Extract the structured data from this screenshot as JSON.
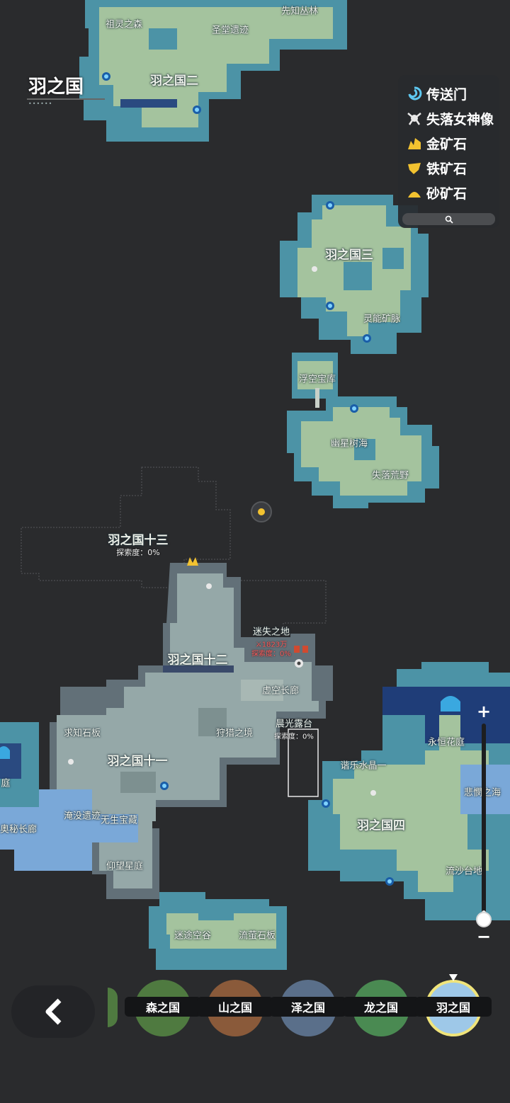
{
  "header": {
    "title": "羽之国",
    "dots": "••••••"
  },
  "legend": {
    "items": [
      {
        "label": "传送门",
        "icon": "teleport-swirl-icon",
        "color": "#5ec8f0"
      },
      {
        "label": "失落女神像",
        "icon": "goddess-statue-icon",
        "color": "#e8e8e8"
      },
      {
        "label": "金矿石",
        "icon": "gold-ore-icon",
        "color": "#f2c230"
      },
      {
        "label": "铁矿石",
        "icon": "iron-ore-icon",
        "color": "#f2c230"
      },
      {
        "label": "砂矿石",
        "icon": "sand-ore-icon",
        "color": "#f2c230"
      }
    ],
    "search_icon": "search-icon"
  },
  "map": {
    "labels": {
      "zulingzhisen": "祖灵之森",
      "xianzhicongling": "先知丛林",
      "shengtangyiji": "圣堂遗迹",
      "yu2": "羽之国二",
      "yu3": "羽之国三",
      "lingnengkuangmai": "灵能矿脉",
      "fukongbaoku": "浮空宝库",
      "youxingshuhai": "幽星树海",
      "shiluohuangye": "失落荒野",
      "yu13": "羽之国十三",
      "yu12": "羽之国十二",
      "mishizhidi": "迷失之地",
      "xukongchanglang": "虚空长廊",
      "chenguanglutai": "晨光露台",
      "qiuzhishiban": "求知石板",
      "shoulie": "狩猎之境",
      "yu11": "羽之国十一",
      "yanmoyiji": "淹没遗迹",
      "wushengbaozang": "无生宝藏",
      "yangwangxingting": "仰望星庭",
      "aomichanglang": "奥秘长廊",
      "ting": "庭",
      "yonghenghuating": "永恒花庭",
      "xieleshuijing": "谐乐水晶一",
      "beishanghai": "悲憫之海",
      "yu4": "羽之国四",
      "liushataidi": "流沙台地",
      "mituwkonggu": "迷途空谷",
      "liuyingshiban": "流萤石板"
    },
    "exploration": {
      "yu13": "探索度：0%",
      "mishi": "探索度：0%",
      "chenguang": "探索度：0%"
    },
    "power": "⚔1823万"
  },
  "zoom": {
    "plus": "+",
    "minus": "−",
    "level": 0.05
  },
  "regions": [
    {
      "label": "森之国",
      "color": "#4f7a40",
      "active": false
    },
    {
      "label": "山之国",
      "color": "#8a5a3a",
      "active": false
    },
    {
      "label": "泽之国",
      "color": "#5a6f8a",
      "active": false
    },
    {
      "label": "龙之国",
      "color": "#4a8a52",
      "active": false
    },
    {
      "label": "羽之国",
      "color": "#9ec8e8",
      "active": true
    }
  ],
  "colors": {
    "background": "#2a2b2d",
    "land_light": "#9fbf9a",
    "land_teal": "#4a8fa2",
    "land_gray": "#8fa3a3",
    "water_dark": "#203a70"
  }
}
